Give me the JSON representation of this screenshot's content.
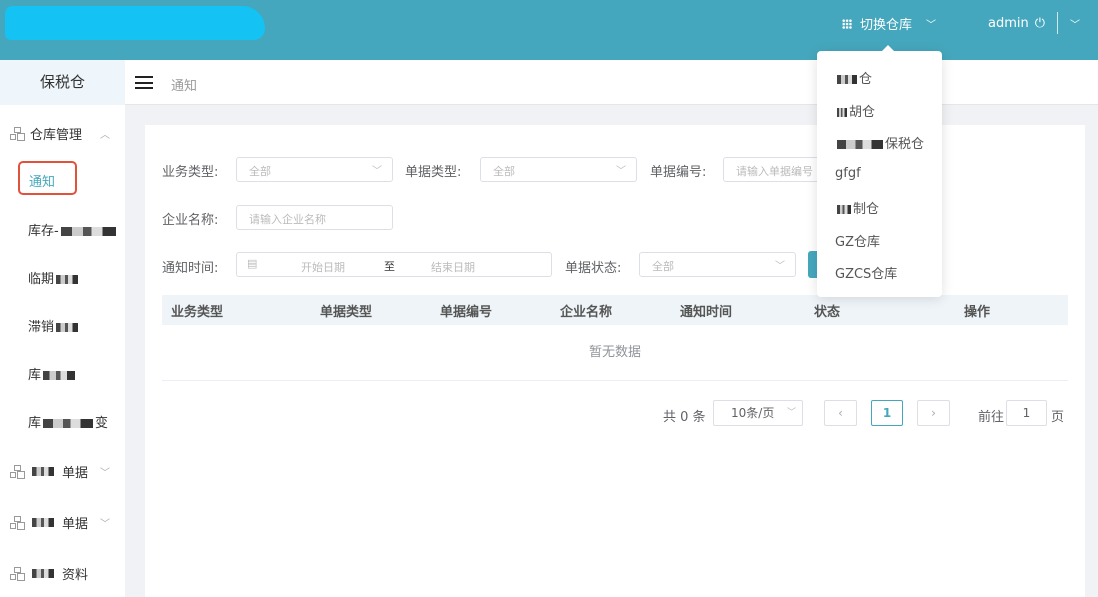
{
  "header": {
    "switch_label": "切换仓库",
    "user": "admin",
    "accent": "#45a7bd"
  },
  "sidebar": {
    "title": "保税仓",
    "groups": [
      {
        "label": "仓库管理",
        "expanded": true
      },
      {
        "label": "单据",
        "prefix_masked": true
      },
      {
        "label": "单据",
        "prefix_masked": true
      },
      {
        "label": "资料",
        "prefix_masked": true
      }
    ],
    "items": [
      {
        "label": "通知",
        "active": true
      },
      {
        "label": "库存-"
      },
      {
        "label": "临期"
      },
      {
        "label": "滞销"
      },
      {
        "label": "库"
      },
      {
        "label": "库",
        "suffix": "变"
      }
    ]
  },
  "breadcrumb": {
    "current": "通知"
  },
  "filters": {
    "biz_type": {
      "label": "业务类型:",
      "value": "全部"
    },
    "doc_type": {
      "label": "单据类型:",
      "value": "全部"
    },
    "doc_no": {
      "label": "单据编号:",
      "placeholder": "请输入单据编号"
    },
    "company": {
      "label": "企业名称:",
      "placeholder": "请输入企业名称"
    },
    "time": {
      "label": "通知时间:",
      "start": "开始日期",
      "sep": "至",
      "end": "结束日期"
    },
    "status": {
      "label": "单据状态:",
      "value": "全部"
    }
  },
  "table": {
    "columns": [
      "业务类型",
      "单据类型",
      "单据编号",
      "企业名称",
      "通知时间",
      "状态",
      "操作"
    ],
    "empty": "暂无数据"
  },
  "pagination": {
    "total": "共 0 条",
    "page_size": "10条/页",
    "current": "1",
    "goto_label": "前往",
    "goto_value": "1",
    "page_unit": "页"
  },
  "warehouse_dropdown": {
    "options": [
      "仓",
      "胡仓",
      "保税仓",
      "gfgf",
      "制仓",
      "GZ仓库",
      "GZCS仓库"
    ]
  }
}
